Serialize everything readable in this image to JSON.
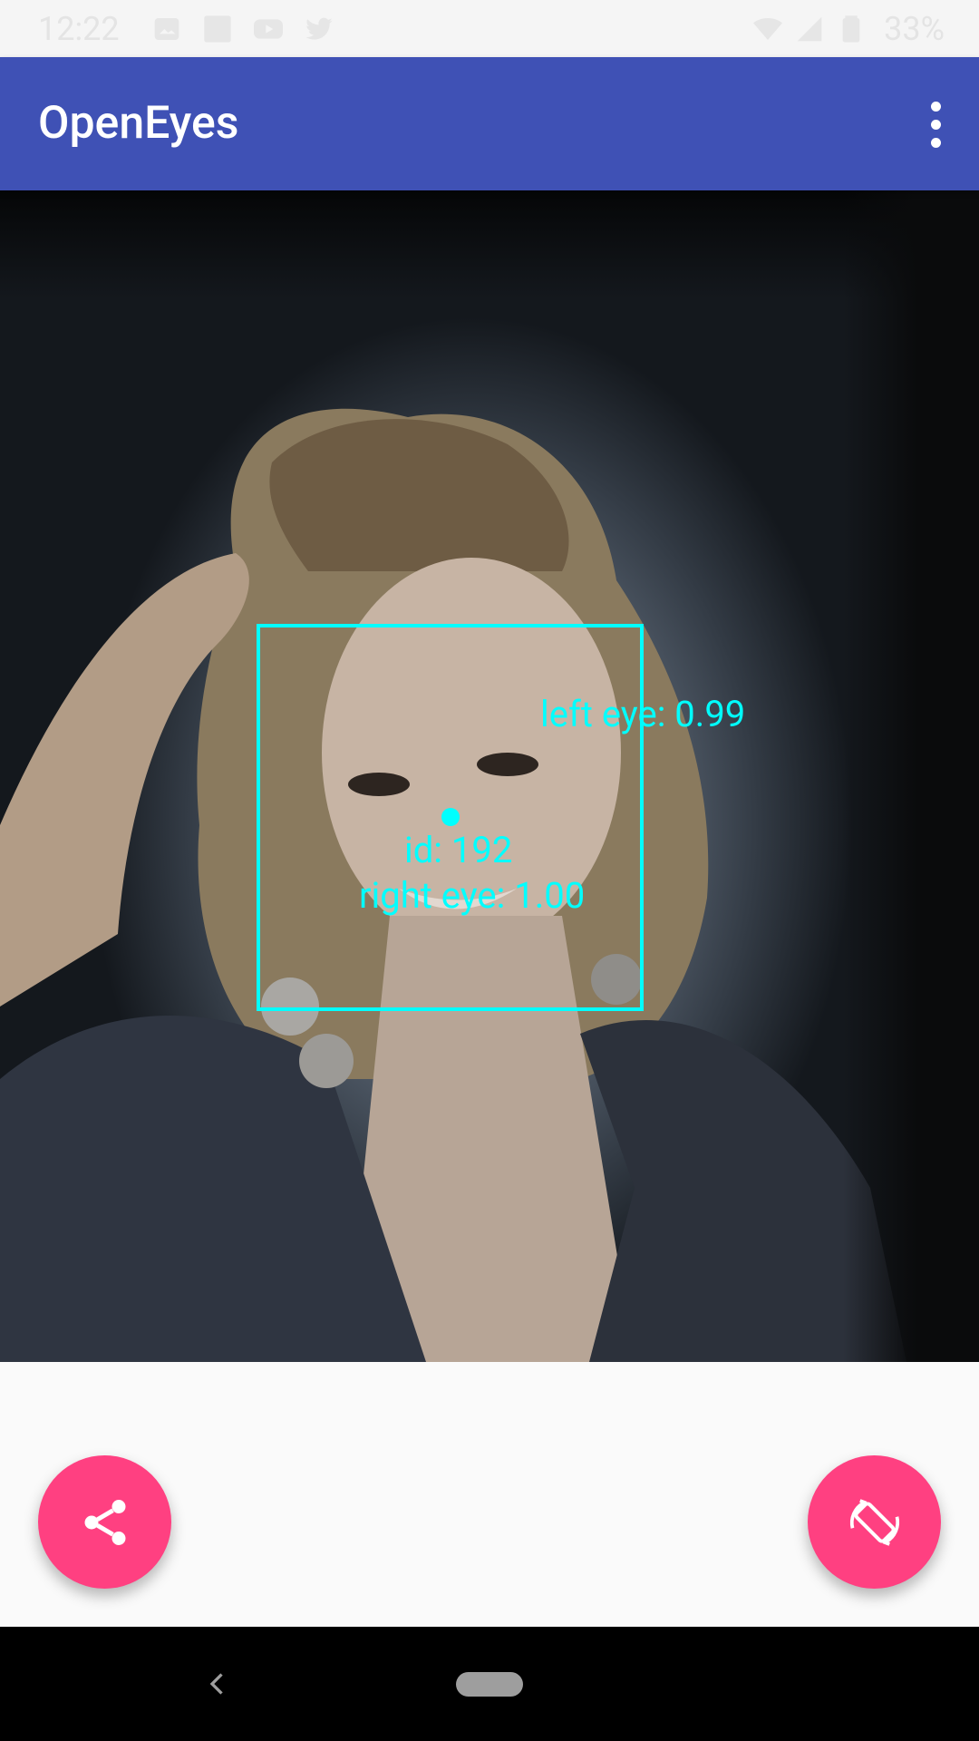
{
  "status_bar": {
    "time": "12:22",
    "notifications": [
      "image-icon",
      "square-icon",
      "youtube-icon",
      "twitter-icon"
    ],
    "battery_percent": "33%"
  },
  "app_bar": {
    "title": "OpenEyes"
  },
  "face_detection": {
    "id_label": "id: 192",
    "left_eye_label": "left eye: 0.99",
    "right_eye_label": "right eye: 1.00",
    "color": "#00ffff"
  },
  "colors": {
    "primary": "#3f51b5",
    "accent": "#ff4081"
  },
  "fabs": {
    "share_icon": "share-icon",
    "flip_icon": "screen-rotation-icon"
  }
}
